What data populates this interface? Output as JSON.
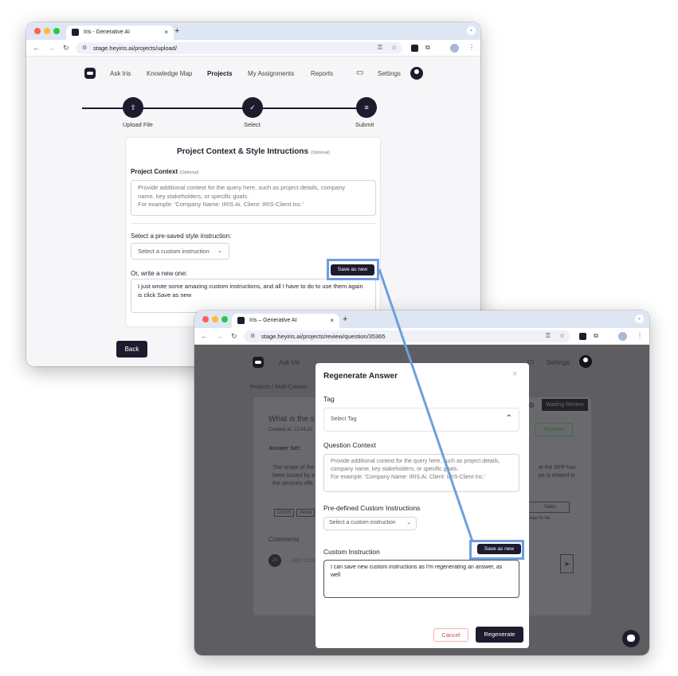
{
  "window1": {
    "tab_title": "Iris - Generative AI",
    "tab_close": "×",
    "new_tab": "+",
    "url": "stage.heyiris.ai/projects/upload/",
    "nav": {
      "ask": "Ask Iris",
      "knowledge": "Knowledge Map",
      "projects": "Projects",
      "assignments": "My Assignments",
      "reports": "Reports",
      "settings": "Settings"
    },
    "steps": [
      {
        "label": "Upload File",
        "icon": "⇧"
      },
      {
        "label": "Select",
        "icon": "✓"
      },
      {
        "label": "Submit",
        "icon": "≡"
      }
    ],
    "card": {
      "title": "Project Context & Style Intructions",
      "title_optional": "(Optional)",
      "context_label": "Project Context",
      "context_optional": "(Optional)",
      "context_placeholder_lines": [
        "Provide additional context for the query here, such as project details, company",
        "name, key stakeholders, or specific goals.",
        "For example: 'Company Name: IRIS Ai. Client: IRIS-Client Inc.'"
      ],
      "preset_label": "Select a pre-saved style instruction:",
      "preset_value": "Select a custom instruction",
      "new_label": "Or, write a new one:",
      "save_button": "Save as new",
      "custom_text": "I just wrote some amazing custom instructions, and all I have to do to use them again is click Save as new"
    },
    "back_button": "Back"
  },
  "window2": {
    "tab_title": "Iris – Generative AI",
    "tab_close": "×",
    "new_tab": "+",
    "url": "stage.heyiris.ai/projects/review/question/35365",
    "background": {
      "ask": "Ask Iris",
      "settings": "Settings",
      "breadcrumb": "Projects / Multi Column",
      "question_title": "What is the s",
      "created": "Created at: 12-04-20",
      "answer_set": "Answer Set:",
      "answer_left": [
        "The scope of the",
        "been issued by a",
        "the services offe"
      ],
      "answer_right": [
        "at the RFP has",
        "pe is related to"
      ],
      "tags": [
        "DCGS",
        "Venta"
      ],
      "status": "Waiting Review",
      "approve": "Approve",
      "sales": "Sales",
      "assign": "ssign To Me",
      "comments": "Comments",
      "comment_avatar": "JV",
      "comment_placeholder": "Add Com"
    },
    "modal": {
      "title": "Regenerate Answer",
      "close": "×",
      "tag_label": "Tag",
      "tag_value": "Select Tag",
      "qc_label": "Question Context",
      "qc_placeholder_lines": [
        "Provide additional context for the query here, such as project details,",
        "company name, key stakeholders, or specific goals.",
        "For example: 'Company Name: IRIS Ai. Client: IRIS-Client Inc.'"
      ],
      "predef_label": "Pre-defined Custom Instructions",
      "predef_value": "Select a custom instruction",
      "custom_label": "Custom Instruction",
      "save_button": "Save as new",
      "custom_text": "I can save new custom instructions as I'm regenerating an answer, as well",
      "cancel_button": "Cancel",
      "regen_button": "Regenerate"
    }
  },
  "colors": {
    "accent": "#1c1c2e",
    "highlight": "#6f9ee0",
    "danger": "#d04b4b"
  }
}
